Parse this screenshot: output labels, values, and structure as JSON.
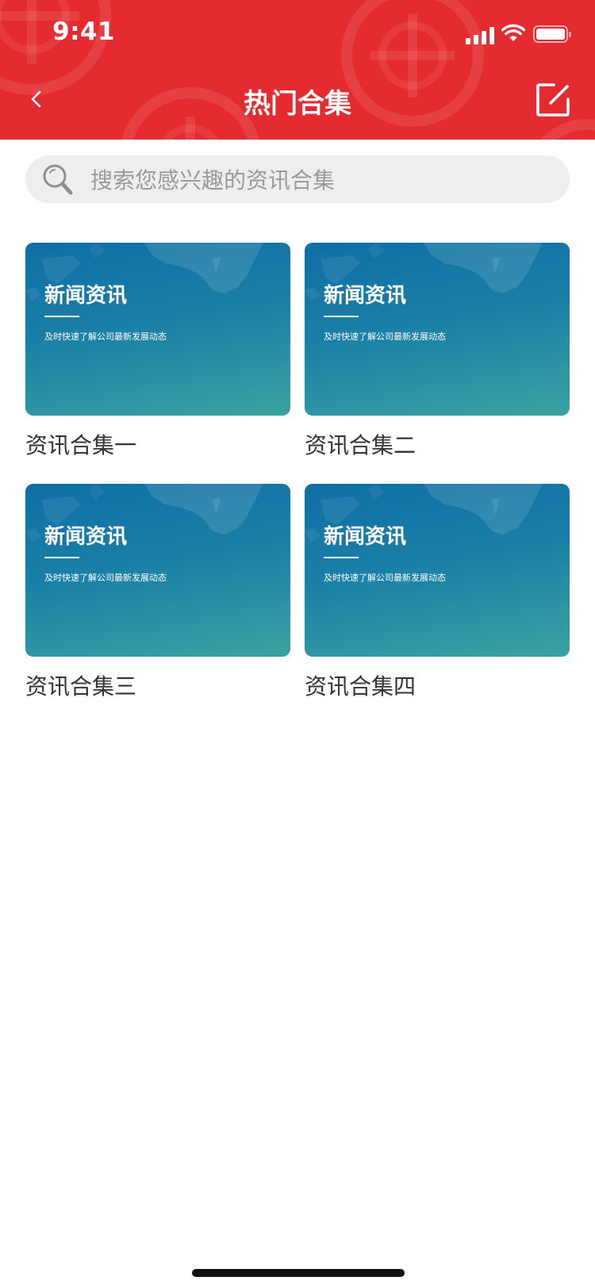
{
  "status_bar": {
    "time": "9:41"
  },
  "header": {
    "title": "热门合集",
    "color": "#e52b2f"
  },
  "search": {
    "placeholder": "搜索您感兴趣的资讯合集"
  },
  "collections": [
    {
      "thumb_title": "新闻资讯",
      "thumb_subtitle": "及时快速了解公司最新发展动态",
      "label": "资讯合集一"
    },
    {
      "thumb_title": "新闻资讯",
      "thumb_subtitle": "及时快速了解公司最新发展动态",
      "label": "资讯合集二"
    },
    {
      "thumb_title": "新闻资讯",
      "thumb_subtitle": "及时快速了解公司最新发展动态",
      "label": "资讯合集三"
    },
    {
      "thumb_title": "新闻资讯",
      "thumb_subtitle": "及时快速了解公司最新发展动态",
      "label": "资讯合集四"
    }
  ],
  "icons": {
    "back": "back-chevron-icon",
    "edit": "edit-icon",
    "search": "search-icon"
  }
}
